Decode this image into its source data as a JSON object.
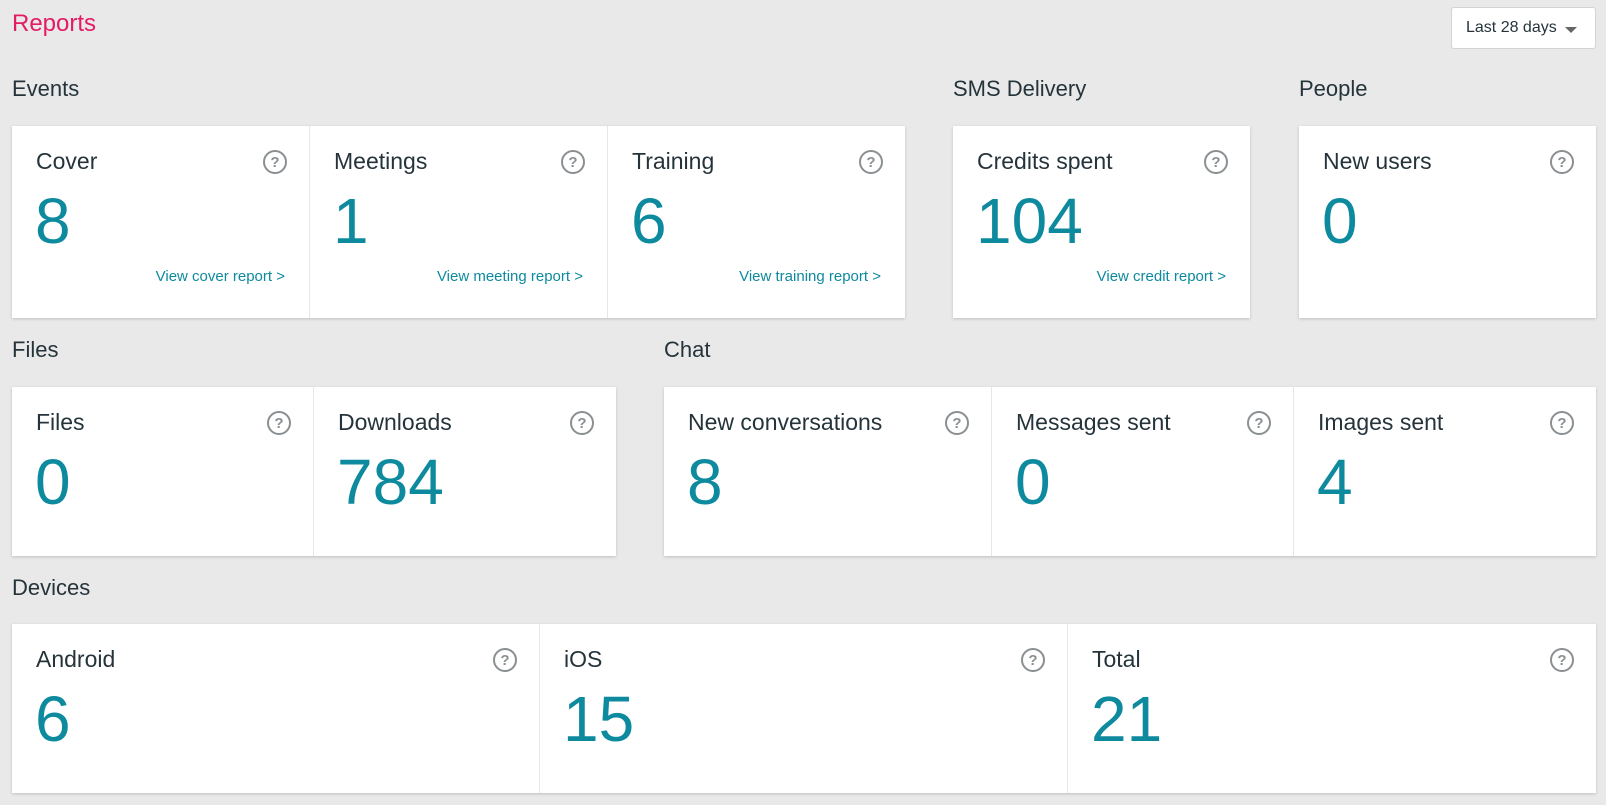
{
  "header": {
    "title": "Reports",
    "date_range": "Last 28 days"
  },
  "sections": {
    "events": {
      "title": "Events",
      "cards": [
        {
          "label": "Cover",
          "value": "8",
          "link": "View cover report >"
        },
        {
          "label": "Meetings",
          "value": "1",
          "link": "View meeting report >"
        },
        {
          "label": "Training",
          "value": "6",
          "link": "View training report >"
        }
      ]
    },
    "sms": {
      "title": "SMS Delivery",
      "cards": [
        {
          "label": "Credits spent",
          "value": "104",
          "link": "View credit report >"
        }
      ]
    },
    "people": {
      "title": "People",
      "cards": [
        {
          "label": "New users",
          "value": "0"
        }
      ]
    },
    "files": {
      "title": "Files",
      "cards": [
        {
          "label": "Files",
          "value": "0"
        },
        {
          "label": "Downloads",
          "value": "784"
        }
      ]
    },
    "chat": {
      "title": "Chat",
      "cards": [
        {
          "label": "New conversations",
          "value": "8"
        },
        {
          "label": "Messages sent",
          "value": "0"
        },
        {
          "label": "Images sent",
          "value": "4"
        }
      ]
    },
    "devices": {
      "title": "Devices",
      "cards": [
        {
          "label": "Android",
          "value": "6"
        },
        {
          "label": "iOS",
          "value": "15"
        },
        {
          "label": "Total",
          "value": "21"
        }
      ]
    }
  },
  "help_icon_glyph": "?",
  "colors": {
    "accent": "#0e8a9e",
    "title": "#e31c63",
    "background": "#e9e9e9"
  }
}
